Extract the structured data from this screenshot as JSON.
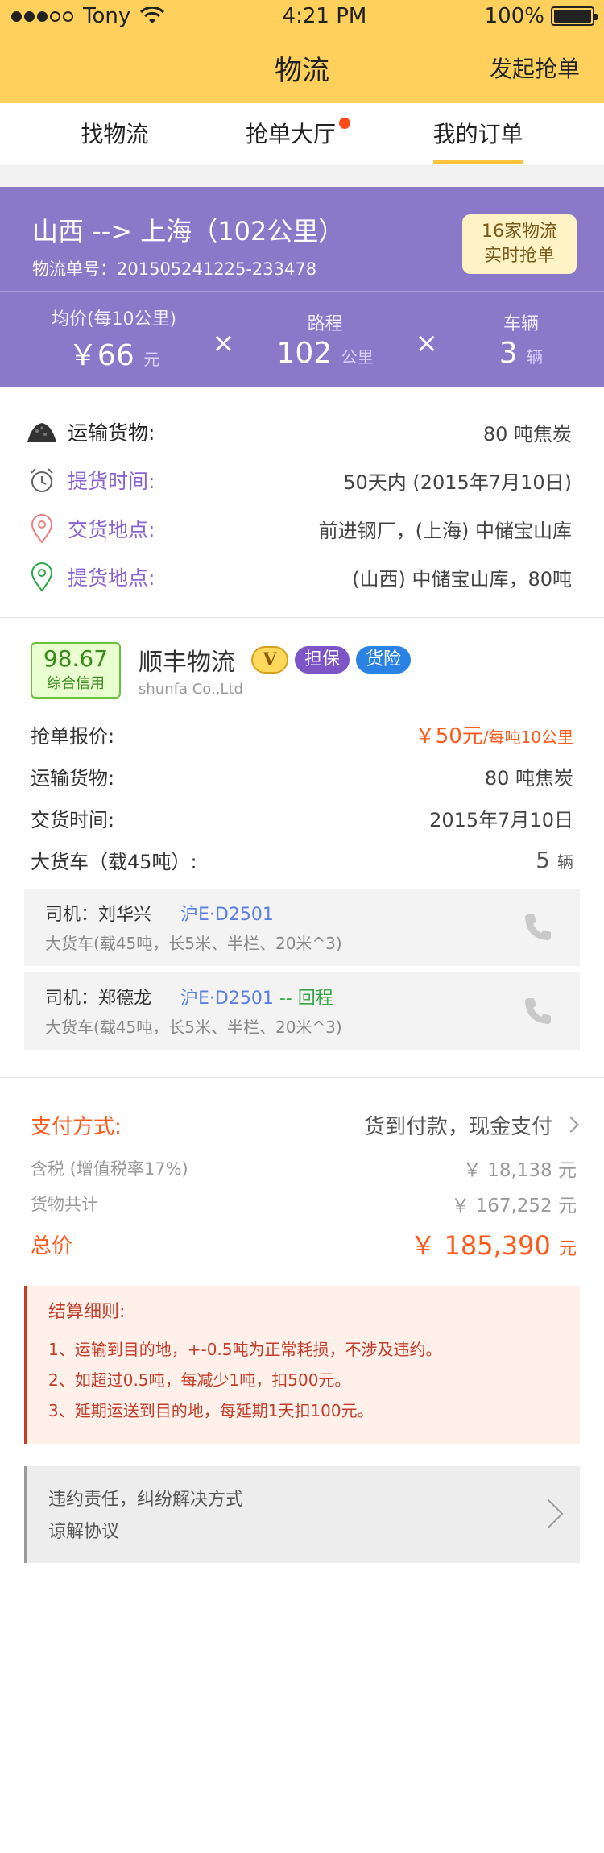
{
  "status": {
    "carrier": "Tony",
    "time": "4:21 PM",
    "battery": "100%",
    "battery_level": 1.0
  },
  "nav": {
    "title": "物流",
    "action": "发起抢单"
  },
  "tabs": [
    {
      "label": "找物流",
      "active": false,
      "badge": false
    },
    {
      "label": "抢单大厅",
      "active": false,
      "badge": true
    },
    {
      "label": "我的订单",
      "active": true,
      "badge": false
    }
  ],
  "route": {
    "title": "山西 --> 上海（102公里）",
    "order_no": "物流单号：201505241225-233478",
    "grab_line1": "16家物流",
    "grab_line2": "实时抢单",
    "stats": {
      "avg_label": "均价(每10公里)",
      "avg_value": "￥66",
      "avg_unit": "元",
      "times1": "×",
      "dist_label": "路程",
      "dist_value": "102",
      "dist_unit": "公里",
      "times2": "×",
      "veh_label": "车辆",
      "veh_value": "3",
      "veh_unit": "辆"
    }
  },
  "cargo": [
    {
      "icon": "coal-pile-icon",
      "label": "运输货物:",
      "value": "80 吨焦炭"
    },
    {
      "icon": "alarm-clock-icon",
      "label": "提货时间:",
      "value": "50天内 (2015年7月10日)"
    },
    {
      "icon": "location-pin-red-icon",
      "label": "交货地点:",
      "value": "前进钢厂，(上海) 中储宝山库"
    },
    {
      "icon": "location-pin-green-icon",
      "label": "提货地点:",
      "value": "(山西) 中储宝山库，80吨"
    }
  ],
  "company": {
    "score": "98.67",
    "score_label": "综合信用",
    "name": "顺丰物流",
    "v_badge": "V",
    "tag1": "担保",
    "tag2": "货险",
    "en_name": "shunfa Co.,Ltd",
    "quote_label": "抢单报价:",
    "quote_value": "￥50元",
    "quote_suffix": "/每吨10公里",
    "goods_label": "运输货物:",
    "goods_value": "80 吨焦炭",
    "delivery_label": "交货时间:",
    "delivery_value": "2015年7月10日",
    "truck_label": "大货车（载45吨）:",
    "truck_count": "5",
    "truck_unit": "辆"
  },
  "drivers": [
    {
      "name": "司机：刘华兴",
      "plate": "沪E·D2501",
      "return": "",
      "desc": "大货车(载45吨，长5米、半栏、20米^3)"
    },
    {
      "name": "司机：郑德龙",
      "plate": "沪E·D2501",
      "return": "-- 回程",
      "desc": "大货车(载45吨，长5米、半栏、20米^3)"
    }
  ],
  "payment": {
    "label": "支付方式:",
    "value": "货到付款，现金支付",
    "tax_label": "含税 (增值税率17%)",
    "tax_value": "￥ 18,138 元",
    "goods_total_label": "货物共计",
    "goods_total_value": "￥ 167,252 元",
    "total_label": "总价",
    "total_value": "￥ 185,390",
    "total_unit": "元"
  },
  "rules": {
    "title": "结算细则:",
    "items": [
      "1、运输到目的地，+-0.5吨为正常耗损，不涉及违约。",
      "2、如超过0.5吨，每减少1吨，扣500元。",
      "3、延期运送到目的地，每延期1天扣100元。"
    ]
  },
  "links": {
    "line1": "违约责任，纠纷解决方式",
    "line2": "谅解协议"
  },
  "colors": {
    "header": "#ffd15c",
    "route": "#8a78c9",
    "accent": "#ff5a1a",
    "purple_label": "#8a63d2"
  }
}
